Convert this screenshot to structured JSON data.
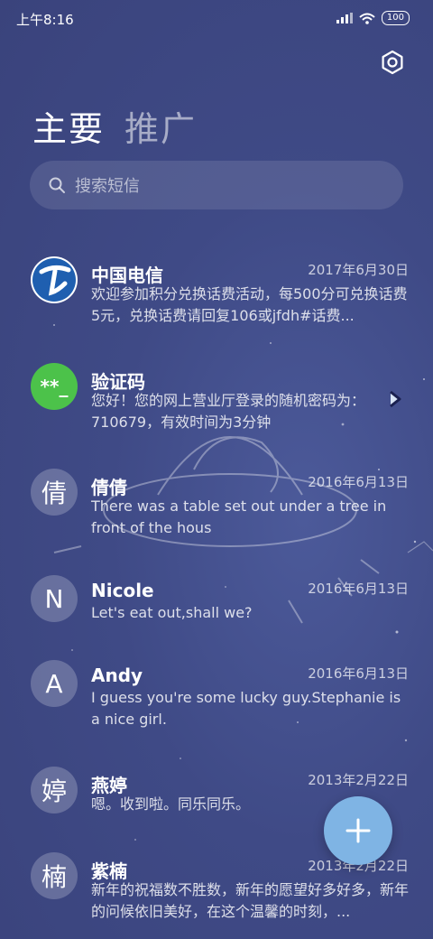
{
  "status_bar": {
    "time": "上午8:16",
    "battery": "100"
  },
  "tabs": [
    {
      "label": "主要"
    },
    {
      "label": "推广"
    }
  ],
  "search": {
    "placeholder": "搜索短信"
  },
  "conversations": [
    {
      "name": "中国电信",
      "date": "2017年6月30日",
      "preview": "欢迎参加积分兑换话费活动，每500分可兑换话费5元，兑换话费请回复106或jfdh#话费...",
      "avatar_icon": "china-telecom-logo"
    },
    {
      "name": "验证码",
      "date": "",
      "preview": "您好！您的网上营业厅登录的随机密码为：710679，有效时间为3分钟",
      "avatar_text": "**_",
      "avatar_color": "#4cc24a"
    },
    {
      "name": "倩倩",
      "date": "2016年6月13日",
      "preview": "There was a table set out under a tree in front of the hous",
      "avatar_text": "倩"
    },
    {
      "name": "Nicole",
      "date": "2016年6月13日",
      "preview": "Let's eat out,shall we?",
      "avatar_text": "N"
    },
    {
      "name": "Andy",
      "date": "2016年6月13日",
      "preview": "I guess you're some lucky guy.Stephanie is a nice girl.",
      "avatar_text": "A"
    },
    {
      "name": "燕婷",
      "date": "2013年2月22日",
      "preview": "嗯。收到啦。同乐同乐。",
      "avatar_text": "婷"
    },
    {
      "name": "紫楠",
      "date": "2013年2月22日",
      "preview": "新年的祝福数不胜数，新年的愿望好多好多，新年的问候依旧美好，在这个温馨的时刻，...",
      "avatar_text": "楠"
    }
  ],
  "icons": {
    "settings": "gear-icon",
    "search": "search-icon",
    "fab": "plus-icon",
    "expand": "chevron-right-icon"
  },
  "colors": {
    "background": "#3f4a86",
    "fab": "#7fb4e4",
    "verification_avatar": "#4cc24a",
    "telecom_blue": "#1f5fb0"
  }
}
